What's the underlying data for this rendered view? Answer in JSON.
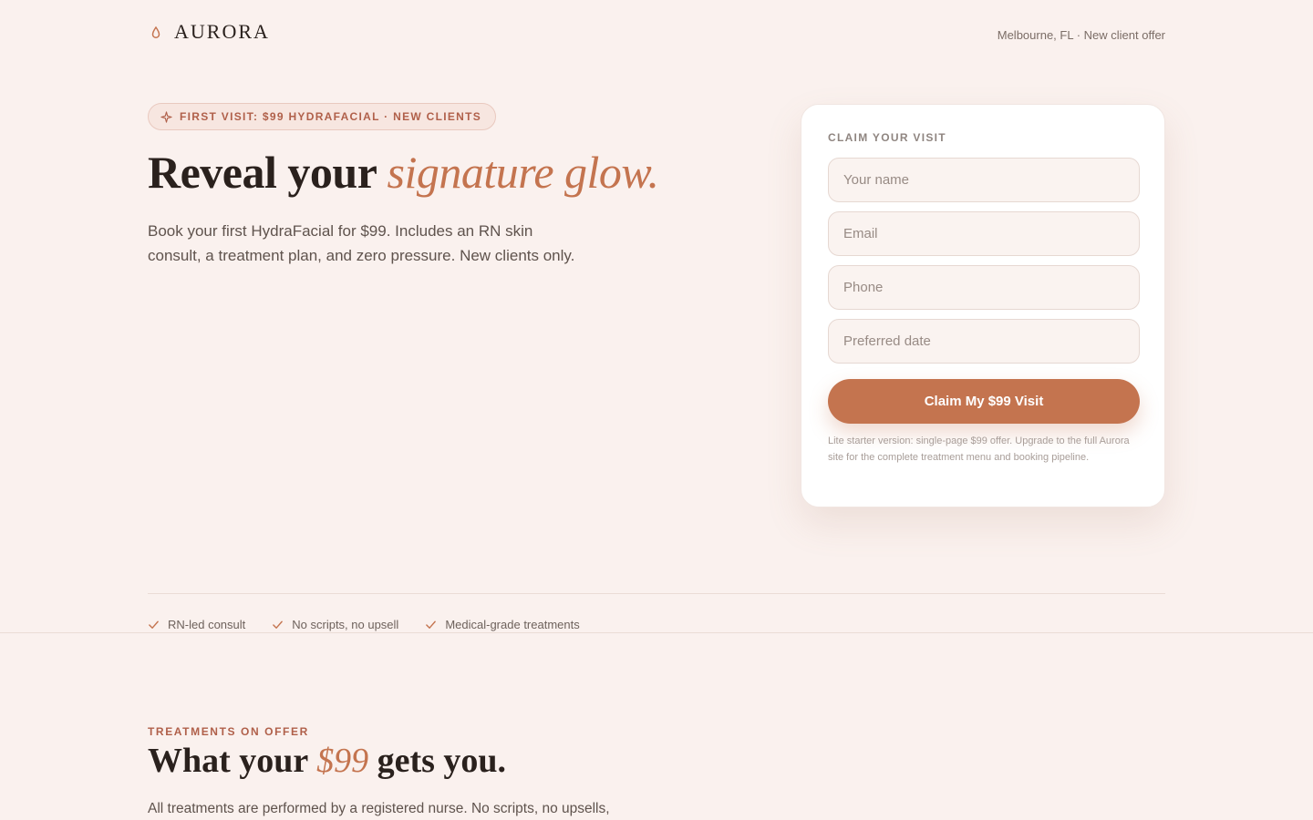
{
  "header": {
    "brand": "AURORA",
    "meta": "Melbourne, FL · New client offer"
  },
  "hero": {
    "badge": "FIRST VISIT: $99 HYDRAFACIAL · NEW CLIENTS",
    "title_main": "Reveal your ",
    "title_accent": "signature glow.",
    "subtitle": "Book your first HydraFacial for $99. Includes an RN skin consult, a treatment plan, and zero pressure. New clients only."
  },
  "form": {
    "label": "CLAIM YOUR VISIT",
    "name_placeholder": "Your name",
    "email_placeholder": "Email",
    "phone_placeholder": "Phone",
    "date_placeholder": "Preferred date",
    "submit_label": "Claim My $99 Visit",
    "note": "Lite starter version: single-page $99 offer. Upgrade to the full Aurora site for the complete treatment menu and booking pipeline."
  },
  "trust": {
    "items": [
      {
        "label": "RN-led consult",
        "icon": "check-icon"
      },
      {
        "label": "No scripts, no upsell",
        "icon": "check-icon"
      },
      {
        "label": "Medical-grade treatments",
        "icon": "check-icon"
      }
    ]
  },
  "treatments": {
    "label": "TREATMENTS ON OFFER",
    "title_before": "What your ",
    "title_accent": "$99",
    "title_after": " gets you.",
    "subtitle": "All treatments are performed by a registered nurse. No scripts, no upsells,"
  },
  "colors": {
    "background": "#faf1ee",
    "accent": "#c4744f",
    "badge_text": "#b0604a",
    "text": "#2a211d"
  },
  "icons": {
    "logo": "droplet-icon",
    "badge": "sparkle-icon"
  }
}
